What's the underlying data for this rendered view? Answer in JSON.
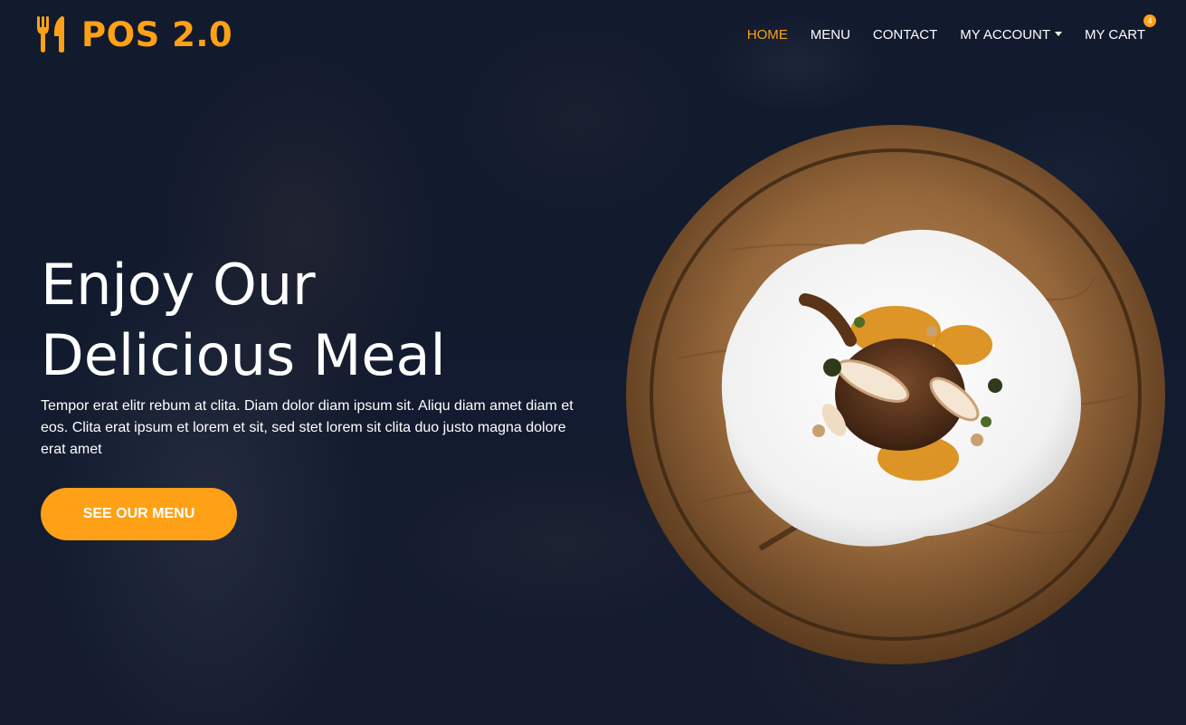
{
  "brand": {
    "name": "POS 2.0",
    "icon": "utensils-icon",
    "color": "#fea116"
  },
  "nav": {
    "items": [
      {
        "label": "HOME",
        "active": true
      },
      {
        "label": "MENU",
        "active": false
      },
      {
        "label": "CONTACT",
        "active": false
      },
      {
        "label": "MY ACCOUNT",
        "active": false,
        "dropdown": true
      },
      {
        "label": "MY CART",
        "active": false
      }
    ],
    "cart_count": "4"
  },
  "hero": {
    "title": "Enjoy Our\nDelicious Meal",
    "text": "Tempor erat elitr rebum at clita. Diam dolor diam ipsum sit. Aliqu diam amet diam et eos. Clita erat ipsum et lorem et sit, sed stet lorem sit clita duo justo magna dolore erat amet",
    "cta_label": "SEE OUR MENU",
    "image": "plated-dish-on-wooden-board"
  },
  "colors": {
    "accent": "#fea116",
    "overlay": "#0f172b",
    "text": "#ffffff"
  }
}
